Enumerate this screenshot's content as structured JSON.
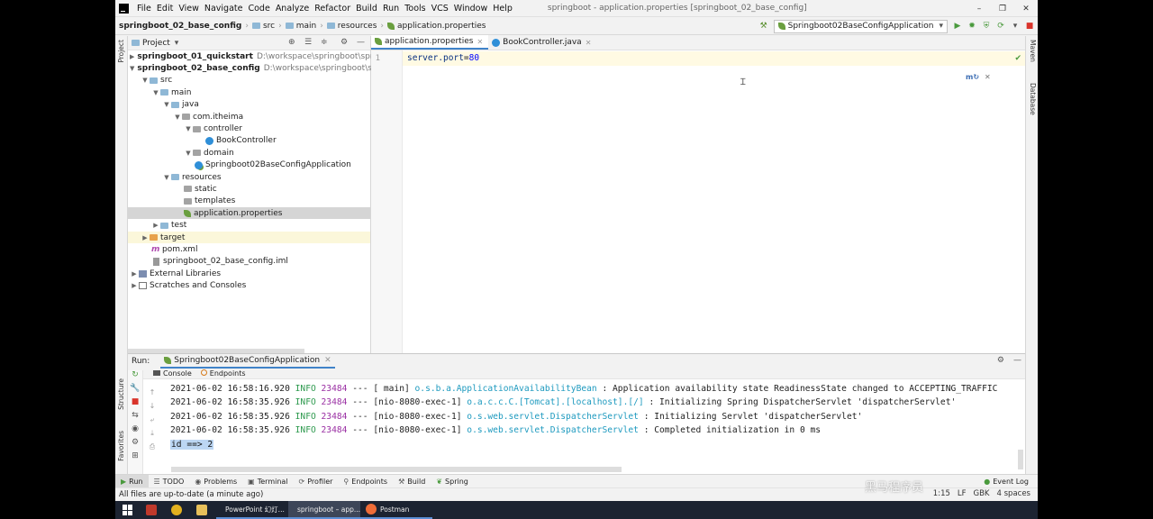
{
  "menu": {
    "items": [
      "File",
      "Edit",
      "View",
      "Navigate",
      "Code",
      "Analyze",
      "Refactor",
      "Build",
      "Run",
      "Tools",
      "VCS",
      "Window",
      "Help"
    ],
    "window_title": "springboot - application.properties [springboot_02_base_config]"
  },
  "nav": {
    "crumbs": [
      "springboot_02_base_config",
      "src",
      "main",
      "resources",
      "application.properties"
    ],
    "run_config": "Springboot02BaseConfigApplication"
  },
  "stripes": {
    "left_top": "Project",
    "left_structure": "Structure",
    "left_favorites": "Favorites",
    "right_maven": "Maven",
    "right_database": "Database"
  },
  "project": {
    "header": "Project",
    "rows": [
      {
        "label": "springboot_01_quickstart",
        "path": "D:\\workspace\\springboot\\sprin"
      },
      {
        "label": "springboot_02_base_config",
        "path": "D:\\workspace\\springboot\\spr"
      },
      {
        "label": "src"
      },
      {
        "label": "main"
      },
      {
        "label": "java"
      },
      {
        "label": "com.itheima"
      },
      {
        "label": "controller"
      },
      {
        "label": "BookController"
      },
      {
        "label": "domain"
      },
      {
        "label": "Springboot02BaseConfigApplication"
      },
      {
        "label": "resources"
      },
      {
        "label": "static"
      },
      {
        "label": "templates"
      },
      {
        "label": "application.properties"
      },
      {
        "label": "test"
      },
      {
        "label": "target"
      },
      {
        "label": "pom.xml"
      },
      {
        "label": "springboot_02_base_config.iml"
      },
      {
        "label": "External Libraries"
      },
      {
        "label": "Scratches and Consoles"
      }
    ]
  },
  "editor": {
    "tabs": [
      "application.properties",
      "BookController.java"
    ],
    "line_number": "1",
    "code_key": "server.port",
    "code_eq": "=",
    "code_val": "80"
  },
  "run": {
    "label": "Run:",
    "tab": "Springboot02BaseConfigApplication",
    "subtabs": [
      "Console",
      "Endpoints"
    ],
    "log": [
      {
        "ts": "2021-06-02 16:58:16.920",
        "lvl": "INFO",
        "pid": "23484",
        "sep": "---",
        "thread": "[           main]",
        "logger": "o.s.b.a.ApplicationAvailabilityBean",
        "msg": ": Application availability state ReadinessState changed to ACCEPTING_TRAFFIC"
      },
      {
        "ts": "2021-06-02 16:58:35.926",
        "lvl": "INFO",
        "pid": "23484",
        "sep": "---",
        "thread": "[nio-8080-exec-1]",
        "logger": "o.a.c.c.C.[Tomcat].[localhost].[/]",
        "msg": ": Initializing Spring DispatcherServlet 'dispatcherServlet'"
      },
      {
        "ts": "2021-06-02 16:58:35.926",
        "lvl": "INFO",
        "pid": "23484",
        "sep": "---",
        "thread": "[nio-8080-exec-1]",
        "logger": "o.s.web.servlet.DispatcherServlet",
        "msg": ": Initializing Servlet 'dispatcherServlet'"
      },
      {
        "ts": "2021-06-02 16:58:35.926",
        "lvl": "INFO",
        "pid": "23484",
        "sep": "---",
        "thread": "[nio-8080-exec-1]",
        "logger": "o.s.web.servlet.DispatcherServlet",
        "msg": ": Completed initialization in 0 ms"
      }
    ],
    "output": "id ==> 2"
  },
  "bottom_tools": [
    "Run",
    "TODO",
    "Problems",
    "Terminal",
    "Profiler",
    "Endpoints",
    "Build",
    "Spring"
  ],
  "event_log": "Event Log",
  "status": {
    "message": "All files are up-to-date (a minute ago)",
    "position": "1:15",
    "line_sep": "LF",
    "encoding": "GBK",
    "indent": "4 spaces"
  },
  "watermark": "黑马程序员",
  "taskbar": {
    "apps": [
      "PowerPoint 幻灯...",
      "springboot – app...",
      "Postman"
    ]
  },
  "colors": {
    "accent": "#4083c9",
    "info": "#2f9a4f",
    "logger": "#1e9abf",
    "pid": "#9a2fa3"
  }
}
